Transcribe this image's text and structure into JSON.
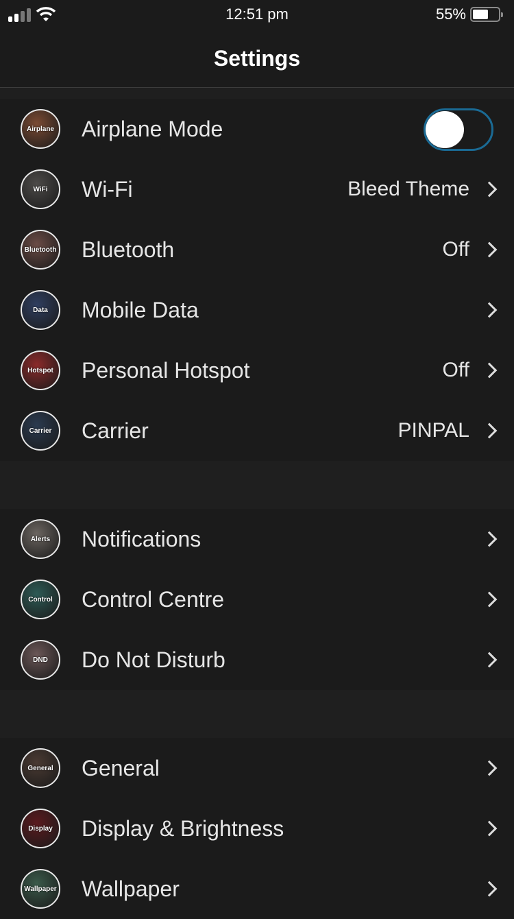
{
  "status_bar": {
    "time": "12:51 pm",
    "battery_percent": "55%",
    "battery_level": 0.55
  },
  "header": {
    "title": "Settings"
  },
  "groups": [
    {
      "items": [
        {
          "icon_label": "Airplane",
          "label": "Airplane Mode",
          "toggle_on": false,
          "color": "#7a4a33"
        },
        {
          "icon_label": "WiFi",
          "label": "Wi-Fi",
          "value": "Bleed Theme",
          "color": "#4c4a48"
        },
        {
          "icon_label": "Bluetooth",
          "label": "Bluetooth",
          "value": "Off",
          "color": "#6a4b45"
        },
        {
          "icon_label": "Data",
          "label": "Mobile Data",
          "value": "",
          "color": "#2f3e5f"
        },
        {
          "icon_label": "Hotspot",
          "label": "Personal Hotspot",
          "value": "Off",
          "color": "#8a2a2a"
        },
        {
          "icon_label": "Carrier",
          "label": "Carrier",
          "value": "PINPAL",
          "color": "#2a3a4f"
        }
      ]
    },
    {
      "items": [
        {
          "icon_label": "Alerts",
          "label": "Notifications",
          "value": "",
          "color": "#6b6560"
        },
        {
          "icon_label": "Control",
          "label": "Control Centre",
          "value": "",
          "color": "#2d5a55"
        },
        {
          "icon_label": "DND",
          "label": "Do Not Disturb",
          "value": "",
          "color": "#6a5656"
        }
      ]
    },
    {
      "items": [
        {
          "icon_label": "General",
          "label": "General",
          "value": "",
          "color": "#4a3a32"
        },
        {
          "icon_label": "Display",
          "label": "Display & Brightness",
          "value": "",
          "color": "#5a1a1e"
        },
        {
          "icon_label": "Wallpaper",
          "label": "Wallpaper",
          "value": "",
          "color": "#3a5a4a"
        }
      ]
    }
  ]
}
